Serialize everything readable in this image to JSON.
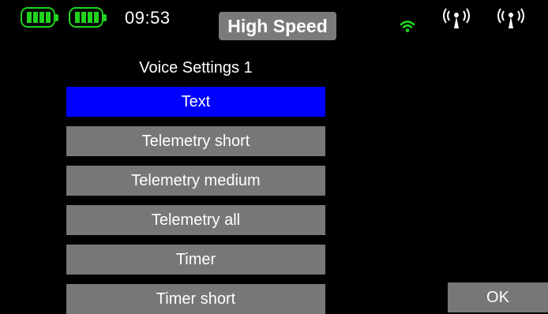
{
  "status_bar": {
    "time": "09:53",
    "mode": "High Speed",
    "icons": [
      "battery-icon",
      "battery-icon",
      "wifi-icon",
      "antenna-icon",
      "antenna-icon"
    ],
    "colors": {
      "battery": "#1fd31f",
      "wifi": "#1fd31f",
      "antenna": "#ffffff",
      "mode_badge": "#7a7a7a"
    }
  },
  "menu": {
    "title": "Voice Settings 1",
    "selected_index": 0,
    "items": [
      {
        "label": "Text"
      },
      {
        "label": "Telemetry short"
      },
      {
        "label": "Telemetry medium"
      },
      {
        "label": "Telemetry all"
      },
      {
        "label": "Timer"
      },
      {
        "label": "Timer short"
      }
    ],
    "colors": {
      "item": "#777777",
      "selected": "#0000ff",
      "background": "#000000"
    }
  },
  "footer": {
    "ok_label": "OK"
  }
}
